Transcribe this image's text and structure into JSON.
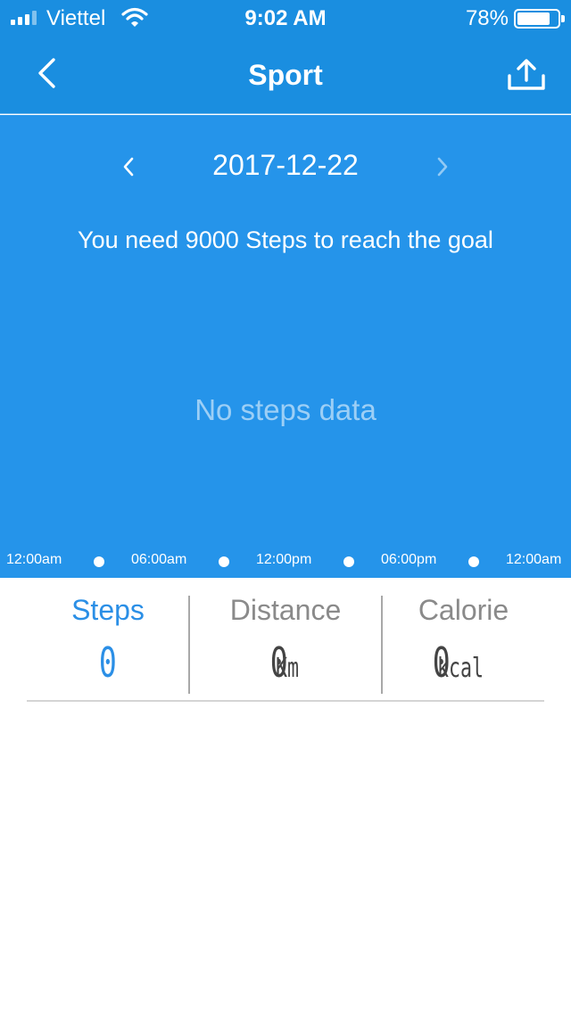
{
  "status_bar": {
    "carrier": "Viettel",
    "time": "9:02 AM",
    "battery": "78%",
    "battery_level": 0.78
  },
  "nav": {
    "title": "Sport",
    "back_icon": "chevron-left-icon",
    "share_icon": "share-upload-icon"
  },
  "date_panel": {
    "date": "2017-12-22",
    "goal_text": "You need 9000 Steps to reach the goal",
    "empty_text": "No steps data",
    "timeline": [
      "12:00am",
      "06:00am",
      "12:00pm",
      "06:00pm",
      "12:00am"
    ]
  },
  "stats": {
    "steps": {
      "label": "Steps",
      "value": "0",
      "unit": ""
    },
    "distance": {
      "label": "Distance",
      "value": "0",
      "unit": "Km"
    },
    "calorie": {
      "label": "Calorie",
      "value": "0",
      "unit": "kcal"
    }
  },
  "colors": {
    "nav_blue": "#1a8ee0",
    "panel_blue": "#2594ea",
    "active_blue": "#2b8fe6"
  }
}
